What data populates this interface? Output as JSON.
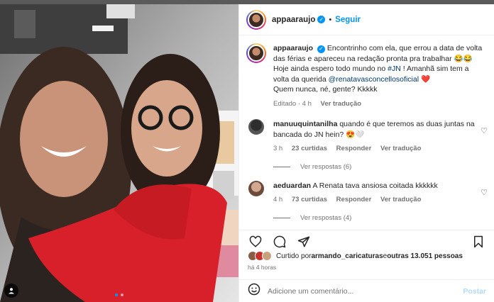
{
  "post": {
    "username": "appaaraujo",
    "follow_label": "Seguir",
    "separator": "•"
  },
  "caption": {
    "username": "appaaraujo",
    "text_1": "Encontrinho com ela, que errou a data de volta das férias e apareceu na redação pronta pra trabalhar 😂😂 Hoje ainda espero todo mundo no ",
    "hashtag": "#JN",
    "text_2": " ! Amanhã sim tem a volta da querida ",
    "mention": "@renatavasconcellosoficial",
    "heart": "❤️",
    "text_3": "Quem nunca, né, gente? Kkkkk",
    "edited": "Editado · 4 h",
    "see_translation": "Ver tradução"
  },
  "comments": [
    {
      "username": "manuuquintanilha",
      "text": "quando é que teremos as duas juntas na bancada do JN hein? 😍🤍",
      "time": "3 h",
      "likes": "23 curtidas",
      "reply": "Responder",
      "translate": "Ver tradução",
      "replies_label": "Ver respostas (6)"
    },
    {
      "username": "aeduardan",
      "text": "A Renata tava ansiosa coitada kkkkkk",
      "time": "4 h",
      "likes": "73 curtidas",
      "reply": "Responder",
      "translate": "Ver tradução",
      "replies_label": "Ver respostas (4)"
    }
  ],
  "likes": {
    "prefix": "Curtido por ",
    "user": "armando_caricaturas",
    "middle": " e ",
    "others": "outras 13.051 pessoas"
  },
  "timestamp": "há 4 horas",
  "add_comment": {
    "placeholder": "Adicione um comentário...",
    "post_label": "Postar"
  },
  "carousel": {
    "total": 2,
    "active": 1
  },
  "colors": {
    "accent": "#0095f6",
    "heart": "#ed4956",
    "link": "#00376b",
    "muted": "#737373",
    "red_shirt": "#d8202a"
  },
  "icons": [
    "verified-icon",
    "heart-outline-icon",
    "comment-icon",
    "share-icon",
    "bookmark-icon",
    "emoji-icon",
    "user-tag-icon"
  ]
}
